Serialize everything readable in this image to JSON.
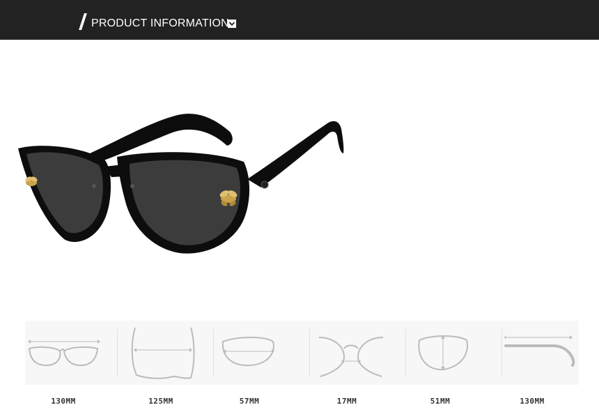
{
  "header": {
    "title": "PRODUCT INFORMATION",
    "chevron_icon": "chevron-down-icon",
    "bg_color": "#222222"
  },
  "product": {
    "image_icon": "cat-eye-sunglasses-with-gold-bee-emblems",
    "frame_color": "#0d0d0d",
    "lens_color": "#3a3a3a",
    "emblem_color": "#c9a24a"
  },
  "dimensions": [
    {
      "icon": "lens-width-diagram-icon",
      "value": "130MM"
    },
    {
      "icon": "front-width-diagram-icon",
      "value": "125MM"
    },
    {
      "icon": "lens-horizontal-diagram-icon",
      "value": "57MM"
    },
    {
      "icon": "bridge-width-diagram-icon",
      "value": "17MM"
    },
    {
      "icon": "lens-height-diagram-icon",
      "value": "51MM"
    },
    {
      "icon": "temple-length-diagram-icon",
      "value": "130MM"
    }
  ]
}
